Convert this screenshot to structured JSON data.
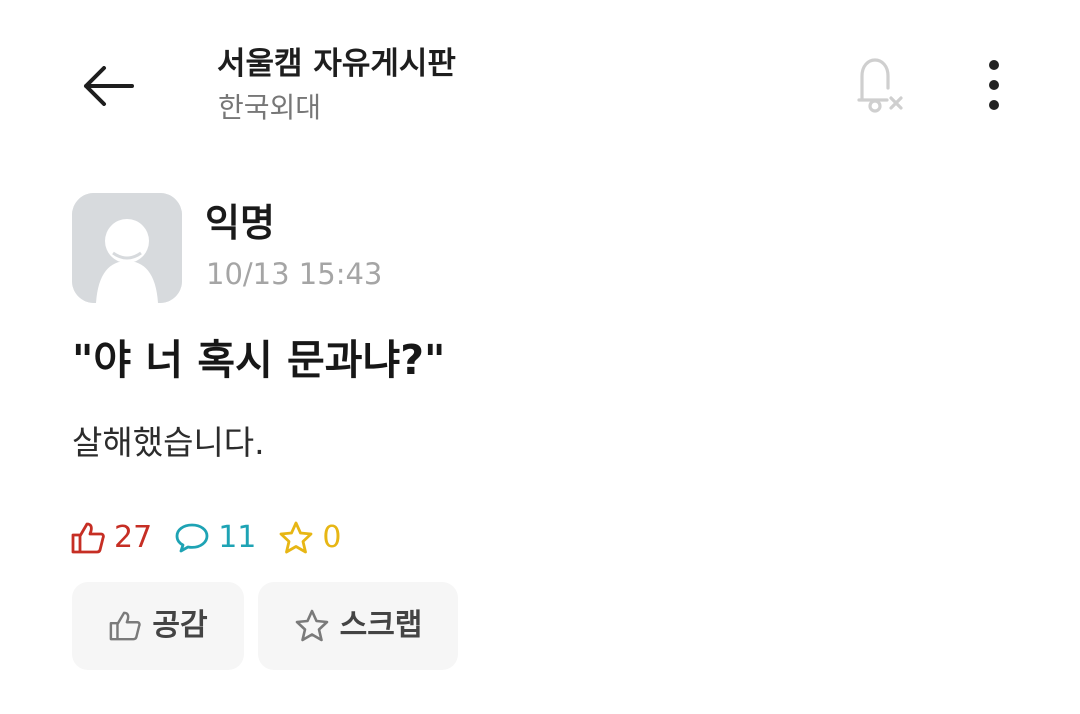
{
  "header": {
    "board_title": "서울캠 자유게시판",
    "school_name": "한국외대",
    "back_icon": "arrow-left-icon",
    "notification_icon": "bell-off-icon",
    "more_icon": "more-vertical-icon"
  },
  "author": {
    "name": "익명",
    "timestamp": "10/13 15:43",
    "avatar_icon": "default-avatar-icon"
  },
  "post": {
    "title": "\"야 너 혹시 문과냐?\"",
    "body": "살해했습니다."
  },
  "stats": {
    "likes": "27",
    "comments": "11",
    "scraps": "0",
    "like_icon": "thumbs-up-icon",
    "comment_icon": "speech-bubble-icon",
    "scrap_icon": "star-icon"
  },
  "actions": {
    "empathy_label": "공감",
    "scrap_label": "스크랩"
  },
  "colors": {
    "like": "#c62e24",
    "comment": "#1ea3b4",
    "scrap": "#e7b614",
    "muted": "#a5a5a5"
  }
}
